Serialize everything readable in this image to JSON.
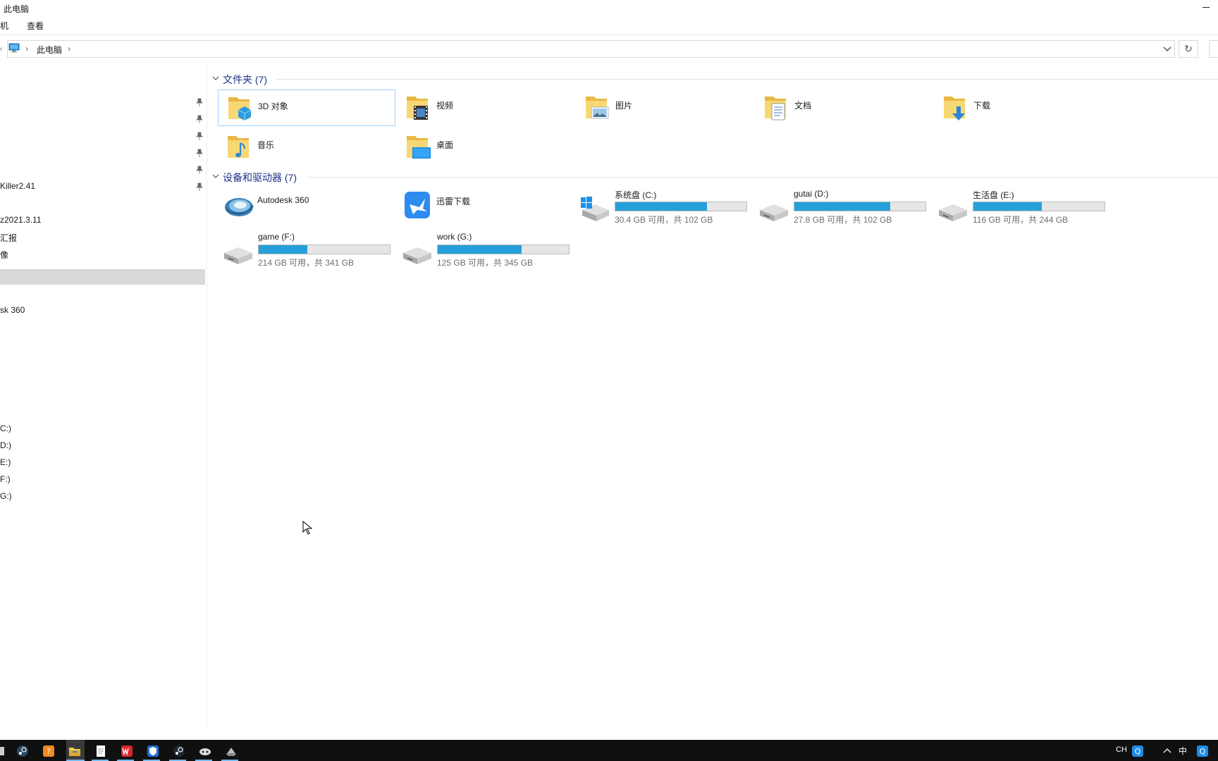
{
  "window": {
    "title": "此电脑"
  },
  "ribbon": {
    "tabs": [
      "机",
      "查看"
    ]
  },
  "address": {
    "crumb": "此电脑",
    "left_stub": "‹",
    "chevron": "›",
    "refresh": "↻"
  },
  "nav": {
    "items": [
      {
        "label": "Killer2.41"
      },
      {
        "label": "z2021.3.11"
      },
      {
        "label": "汇报"
      },
      {
        "label": "像"
      },
      {
        "label": ""
      },
      {
        "label": "sk 360"
      },
      {
        "label": "C:)"
      },
      {
        "label": "D:)"
      },
      {
        "label": "E:)"
      },
      {
        "label": "F:)"
      },
      {
        "label": "G:)"
      }
    ]
  },
  "folders": {
    "header": "文件夹 (7)",
    "items": [
      {
        "label": "3D 对象",
        "icon": "3d-objects-folder-icon"
      },
      {
        "label": "视频",
        "icon": "videos-folder-icon"
      },
      {
        "label": "图片",
        "icon": "pictures-folder-icon"
      },
      {
        "label": "文档",
        "icon": "documents-folder-icon"
      },
      {
        "label": "下载",
        "icon": "downloads-folder-icon"
      },
      {
        "label": "音乐",
        "icon": "music-folder-icon"
      },
      {
        "label": "桌面",
        "icon": "desktop-folder-icon"
      }
    ]
  },
  "devices": {
    "header": "设备和驱动器 (7)",
    "apps": [
      {
        "label": "Autodesk 360",
        "icon": "autodesk-360-icon"
      },
      {
        "label": "迅雷下载",
        "icon": "xunlei-icon"
      }
    ],
    "drives": [
      {
        "name": "系统盘 (C:)",
        "free": "30.4 GB 可用，共 102 GB",
        "used_fraction": 0.7,
        "icon": "windows-drive-icon"
      },
      {
        "name": "gutai (D:)",
        "free": "27.8 GB 可用，共 102 GB",
        "used_fraction": 0.73,
        "icon": "hard-drive-icon"
      },
      {
        "name": "生活盘 (E:)",
        "free": "116 GB 可用，共 244 GB",
        "used_fraction": 0.52,
        "icon": "hard-drive-icon"
      },
      {
        "name": "game (F:)",
        "free": "214 GB 可用，共 341 GB",
        "used_fraction": 0.37,
        "icon": "hard-drive-icon"
      },
      {
        "name": "work (G:)",
        "free": "125 GB 可用，共 345 GB",
        "used_fraction": 0.64,
        "icon": "hard-drive-icon"
      }
    ]
  },
  "taskbar": {
    "tray": {
      "lang": "CH",
      "ime": "中"
    }
  },
  "colors": {
    "accent": "#26a0da",
    "header": "#1e3287",
    "selection_border": "#99d1ff"
  }
}
